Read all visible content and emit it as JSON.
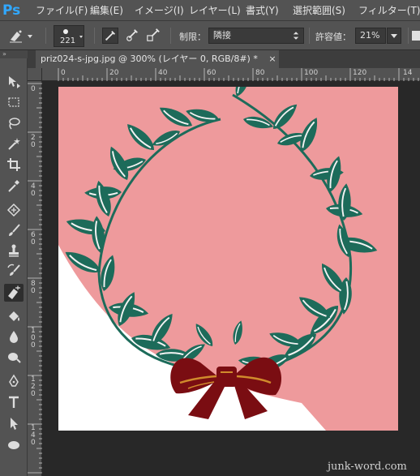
{
  "app": {
    "logo": "Ps"
  },
  "menu": [
    {
      "label": "ファイル(F)"
    },
    {
      "label": "編集(E)"
    },
    {
      "label": "イメージ(I)"
    },
    {
      "label": "レイヤー(L)"
    },
    {
      "label": "書式(Y)"
    },
    {
      "label": "選択範囲(S)"
    },
    {
      "label": "フィルター(T)"
    }
  ],
  "options": {
    "brush_size": "221",
    "limits_label": "制限：",
    "limits_value": "隣接",
    "tolerance_label": "許容値：",
    "tolerance_value": "21%",
    "icons": [
      "background-eraser-icon",
      "sampling-continuous-icon",
      "sampling-once-icon",
      "sampling-swatch-icon"
    ]
  },
  "document": {
    "tab_title": "priz024-s-jpg.jpg @ 300% (レイヤー 0, RGB/8#) *",
    "close_glyph": "×"
  },
  "ruler": {
    "h_labels": [
      "0",
      "20",
      "40",
      "60",
      "80",
      "100",
      "120",
      "14"
    ],
    "v_labels": [
      "0",
      "20",
      "40",
      "60",
      "80",
      "100",
      "120",
      "140"
    ]
  },
  "tools": [
    {
      "name": "move-tool-icon"
    },
    {
      "name": "marquee-tool-icon"
    },
    {
      "name": "lasso-tool-icon"
    },
    {
      "name": "magic-wand-tool-icon"
    },
    {
      "name": "crop-tool-icon"
    },
    {
      "name": "eyedropper-tool-icon"
    },
    {
      "name": "healing-brush-tool-icon"
    },
    {
      "name": "brush-tool-icon"
    },
    {
      "name": "clone-stamp-tool-icon"
    },
    {
      "name": "history-brush-tool-icon"
    },
    {
      "name": "background-eraser-tool-icon",
      "active": true
    },
    {
      "name": "paint-bucket-tool-icon"
    },
    {
      "name": "blur-tool-icon"
    },
    {
      "name": "dodge-tool-icon"
    },
    {
      "name": "pen-tool-icon"
    },
    {
      "name": "type-tool-icon"
    },
    {
      "name": "path-selection-tool-icon"
    },
    {
      "name": "ellipse-tool-icon"
    }
  ],
  "colors": {
    "canvas_pink": "#ee9a9c",
    "leaf_green": "#1d6b5a",
    "ribbon_red": "#7a0d12",
    "ribbon_gold": "#d08a2c"
  },
  "watermark": "junk-word.com"
}
